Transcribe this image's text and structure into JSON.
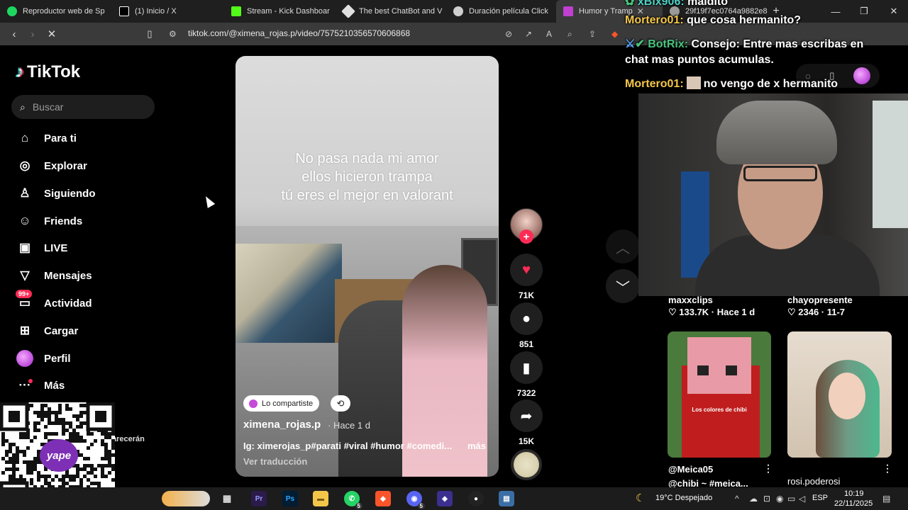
{
  "browser": {
    "tabs": [
      {
        "label": "Reproductor web de Sp",
        "icon_color": "#1ed760"
      },
      {
        "label": "(1) Inicio / X",
        "icon_color": "#ffffff"
      },
      {
        "label": "Stream - Kick Dashboar",
        "icon_color": "#53fc18"
      },
      {
        "label": "The best ChatBot and V",
        "icon_color": "#e0e0e0"
      },
      {
        "label": "Duración película Click",
        "icon_color": "#cfcfcf"
      },
      {
        "label": "Humor y Tramp",
        "icon_color": "#c040d0"
      },
      {
        "label": "29f19f7ec0764a9882e8",
        "icon_color": "#9a9a9a"
      }
    ],
    "new_tab": "+",
    "url": "tiktok.com/@ximena_rojas.p/video/7575210356570606868"
  },
  "tiktok": {
    "logo": "TikTok",
    "search_placeholder": "Buscar",
    "nav": [
      {
        "label": "Para ti",
        "icon": "home-icon"
      },
      {
        "label": "Explorar",
        "icon": "compass-icon"
      },
      {
        "label": "Siguiendo",
        "icon": "following-icon"
      },
      {
        "label": "Friends",
        "icon": "friends-icon"
      },
      {
        "label": "LIVE",
        "icon": "live-icon"
      },
      {
        "label": "Mensajes",
        "icon": "messages-icon"
      },
      {
        "label": "Actividad",
        "icon": "activity-icon",
        "badge": "99+"
      },
      {
        "label": "Cargar",
        "icon": "upload-icon"
      },
      {
        "label": "Perfil",
        "icon": "profile-avatar"
      },
      {
        "label": "Más",
        "icon": "more-icon"
      }
    ],
    "partial_text": "arecerán",
    "video": {
      "overlay_text": "No pasa nada mi amor\nellos hicieron trampa\ntú eres el mejor en valorant",
      "shared_label": "Lo compartiste",
      "author": "ximena_rojas.p",
      "posted": "· Hace 1 d",
      "caption": "Ig: ximerojas_p#parati #viral #humor #comedi...",
      "more_label": "más",
      "translate_label": "Ver traducción"
    },
    "actions": {
      "likes": "71K",
      "comments": "851",
      "saves": "7322",
      "shares": "15K"
    },
    "recommendations": [
      {
        "author": "maxxclips",
        "stats": "♡ 133.7K · Hace 1 d"
      },
      {
        "author": "chayopresente",
        "stats": "♡ 2346 · 11-7"
      },
      {
        "author": "@Meica05",
        "title": "@chibi ~ #meica...",
        "overlay": "Los colores de chibi"
      },
      {
        "author": "rosi.poderosi"
      }
    ]
  },
  "chat": [
    {
      "user": "xBix906:",
      "message": "maldito"
    },
    {
      "user": "Mortero01:",
      "message": "que cosa hermanito?"
    },
    {
      "user": "BotRix:",
      "message": "Consejo: Entre mas escribas en"
    },
    {
      "user": "",
      "message": "chat mas puntos acumulas."
    },
    {
      "user": "Mortero01:",
      "message": "no vengo de x hermanito"
    }
  ],
  "qr": {
    "brand": "yape"
  },
  "taskbar": {
    "weather": "19°C  Despejado",
    "lang": "ESP",
    "time": "10:19",
    "date": "22/11/2025",
    "whatsapp_badge": "5",
    "discord_badge": "5"
  }
}
